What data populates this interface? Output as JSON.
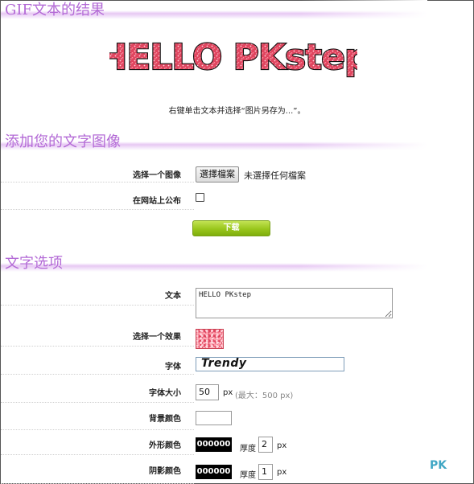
{
  "sections": {
    "result_title": "GIF文本的结果",
    "add_title": "添加您的文字图像",
    "options_title": "文字选项"
  },
  "result": {
    "gif_text": "HELLO PKstep",
    "caption": "右键单击文本并选择“图片另存为...”。"
  },
  "add": {
    "choose_image_label": "选择一个图像",
    "file_button": "選擇檔案",
    "file_status": "未選擇任何檔案",
    "publish_label": "在网站上公布",
    "download_button": "下载"
  },
  "options": {
    "text_label": "文本",
    "text_value": "HELLO PKstep",
    "effect_label": "选择一个效果",
    "font_label": "字体",
    "font_value": "Trendy",
    "font_size_label": "字体大小",
    "font_size_value": "50",
    "font_size_unit": "px",
    "font_size_hint": "(最大：500 px)",
    "bg_color_label": "背景颜色",
    "outline_color_label": "外形颜色",
    "outline_color_value": "000000",
    "outline_thickness_label": "厚度",
    "outline_thickness_value": "2",
    "outline_unit": "px",
    "shadow_color_label": "阴影颜色",
    "shadow_color_value": "000000",
    "shadow_thickness_label": "厚度",
    "shadow_thickness_value": "1",
    "shadow_unit": "px"
  },
  "watermark": {
    "brand": "PK",
    "tagline": ""
  },
  "colors": {
    "accent": "#b36ad6",
    "header_glow": "#e7c8f3",
    "download_green": "#99c61c",
    "gif_pink": "#e0455f"
  }
}
